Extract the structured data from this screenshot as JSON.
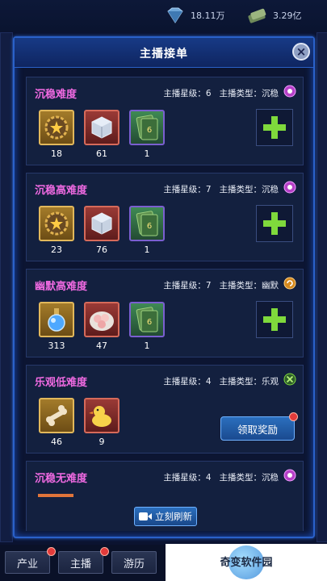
{
  "resources": {
    "diamond": "18.11万",
    "cash": "3.29亿"
  },
  "modal": {
    "title": "主播接单",
    "close_label": "×",
    "refresh_label": "立刻刷新"
  },
  "labels": {
    "star_level": "主播星级：",
    "anchor_type": "主播类型："
  },
  "orders": [
    {
      "title": "沉稳难度",
      "star": "6",
      "type": "沉稳",
      "type_icon": "purple-gear-icon",
      "items": [
        {
          "icon": "gear-medal-icon",
          "count": "18",
          "frame": "gold"
        },
        {
          "icon": "ice-cube-icon",
          "count": "61",
          "frame": "red"
        },
        {
          "icon": "card-icon",
          "count": "1",
          "frame": "green"
        }
      ],
      "action": "plus"
    },
    {
      "title": "沉稳高难度",
      "star": "7",
      "type": "沉稳",
      "type_icon": "purple-gear-icon",
      "items": [
        {
          "icon": "gear-medal-icon",
          "count": "23",
          "frame": "gold"
        },
        {
          "icon": "ice-cube-icon",
          "count": "76",
          "frame": "red"
        },
        {
          "icon": "card-icon",
          "count": "1",
          "frame": "green"
        }
      ],
      "action": "plus"
    },
    {
      "title": "幽默高难度",
      "star": "7",
      "type": "幽默",
      "type_icon": "orange-swirl-icon",
      "items": [
        {
          "icon": "potion-icon",
          "count": "313",
          "frame": "gold"
        },
        {
          "icon": "flower-plate-icon",
          "count": "47",
          "frame": "red"
        },
        {
          "icon": "card-icon",
          "count": "1",
          "frame": "green"
        }
      ],
      "action": "plus"
    },
    {
      "title": "乐观低难度",
      "star": "4",
      "type": "乐观",
      "type_icon": "green-cross-icon",
      "items": [
        {
          "icon": "bone-icon",
          "count": "46",
          "frame": "gold"
        },
        {
          "icon": "rubber-duck-icon",
          "count": "9",
          "frame": "red"
        }
      ],
      "action": "claim",
      "claim_label": "领取奖励"
    },
    {
      "title": "沉稳无难度",
      "star": "4",
      "type": "沉稳",
      "type_icon": "purple-gear-icon",
      "items": [],
      "action": "none"
    }
  ],
  "nav": [
    {
      "label": "产业"
    },
    {
      "label": "主播"
    },
    {
      "label": "游历"
    }
  ],
  "watermark": "奇变软件园"
}
